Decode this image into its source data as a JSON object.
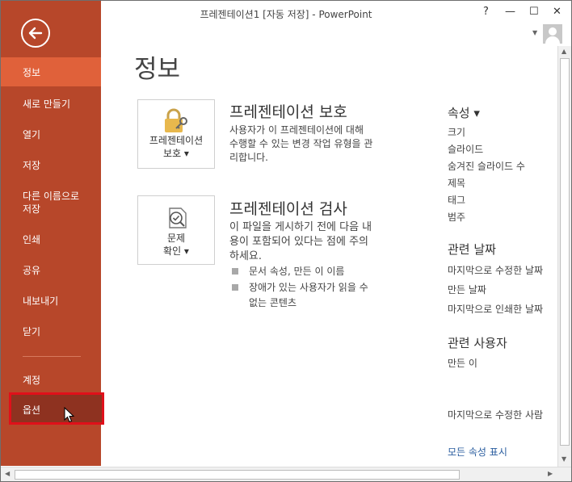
{
  "window": {
    "title": "프레젠테이션1 [자동 저장] - PowerPoint",
    "help": "?",
    "minimize": "—",
    "maximize": "☐",
    "close": "✕"
  },
  "sidebar": {
    "items": [
      {
        "label": "정보"
      },
      {
        "label": "새로 만들기"
      },
      {
        "label": "열기"
      },
      {
        "label": "저장"
      },
      {
        "label": "다른 이름으로"
      },
      {
        "label": "저장"
      },
      {
        "label": "인쇄"
      },
      {
        "label": "공유"
      },
      {
        "label": "내보내기"
      },
      {
        "label": "닫기"
      },
      {
        "label": "계정"
      },
      {
        "label": "옵션"
      }
    ]
  },
  "main": {
    "title": "정보",
    "protect": {
      "tile_line1": "프레젠테이션",
      "tile_line2": "보호 ▾",
      "heading": "프레젠테이션 보호",
      "desc1": "사용자가 이 프레젠테이션에 대해",
      "desc2": "수행할 수 있는 변경 작업 유형을 관",
      "desc3": "리합니다."
    },
    "inspect": {
      "tile_line1": "문제",
      "tile_line2": "확인 ▾",
      "heading": "프레젠테이션 검사",
      "desc1": "이 파일을 게시하기 전에 다음 내",
      "desc2": "용이 포함되어 있다는 점에 주의",
      "desc3": "하세요.",
      "bullet1": "문서 속성, 만든 이 이름",
      "bullet2a": "장애가 있는 사용자가 읽을 수",
      "bullet2b": "없는 콘텐츠"
    }
  },
  "properties": {
    "heading": "속성 ▾",
    "items": [
      "크기",
      "슬라이드",
      "숨겨진 슬라이드 수",
      "제목",
      "태그",
      "범주"
    ],
    "dates_heading": "관련 날짜",
    "dates": [
      "마지막으로 수정한 날짜",
      "만든 날짜",
      "마지막으로 인쇄한 날짜"
    ],
    "people_heading": "관련 사용자",
    "people": [
      "만든 이",
      "마지막으로 수정한 사람"
    ],
    "show_all": "모든 속성 표시"
  },
  "colors": {
    "sidebar": "#b7472a",
    "sidebar_active": "#e0613a",
    "highlight": "#e0101a",
    "link": "#2a5d9f"
  }
}
